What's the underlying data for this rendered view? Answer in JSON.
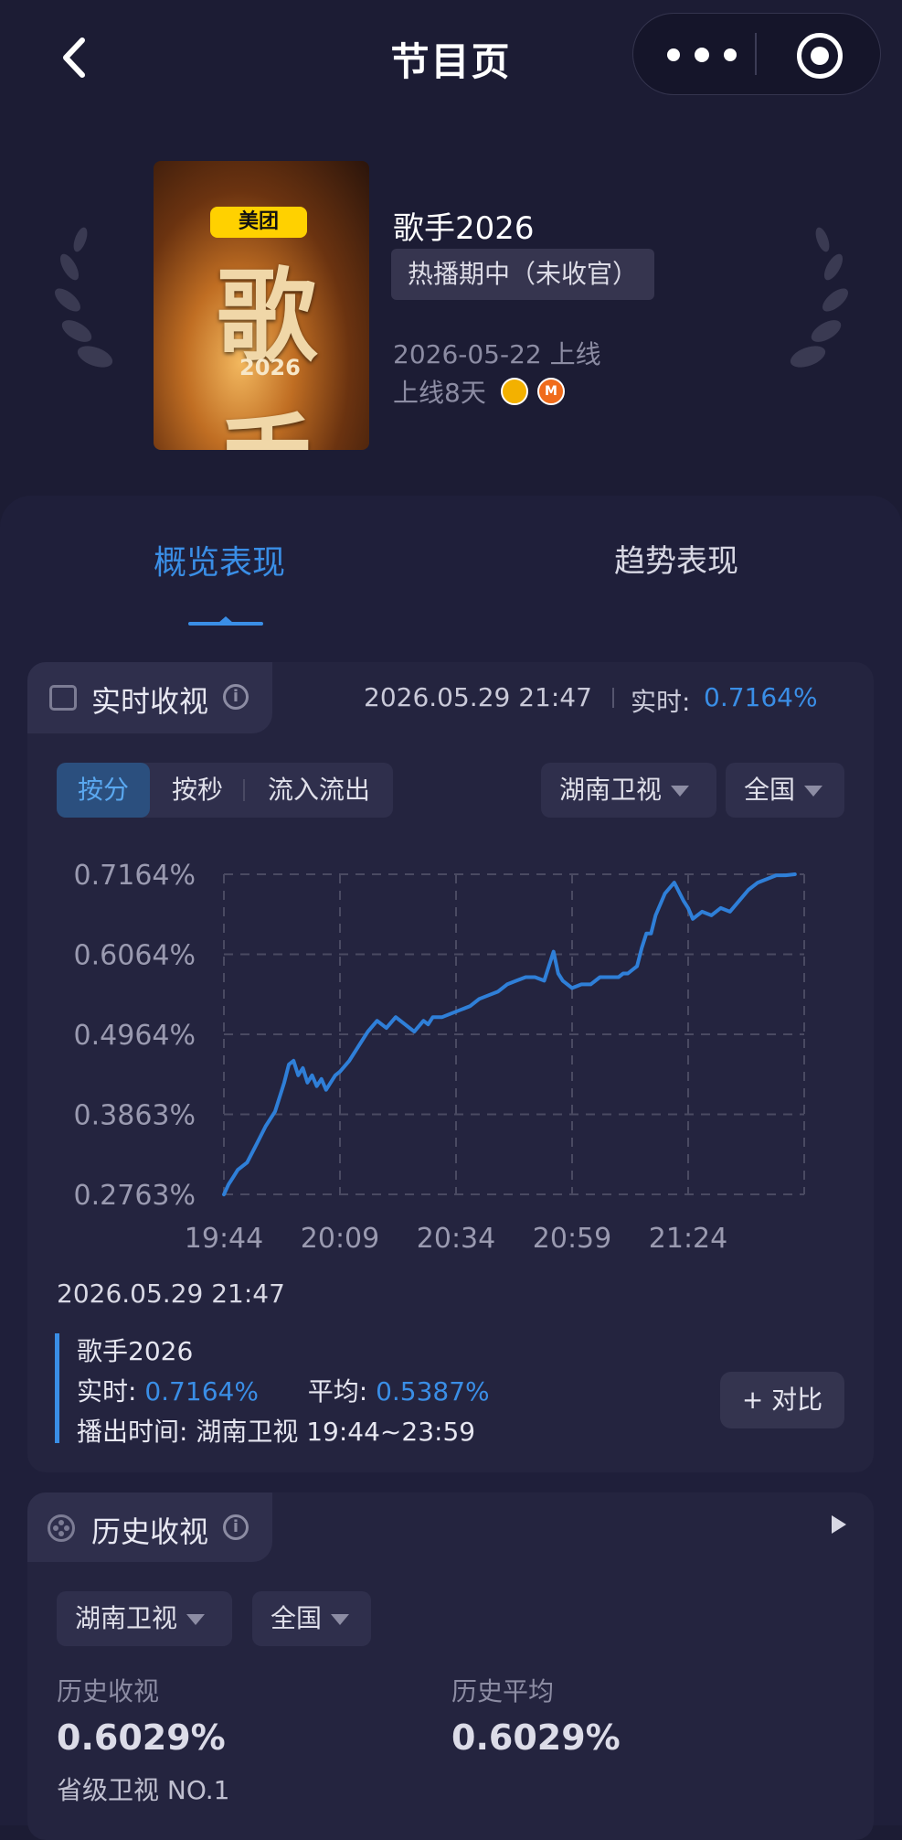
{
  "nav": {
    "title": "节目页"
  },
  "show": {
    "poster_logo": "美团",
    "poster_title": "歌手",
    "poster_year": "2026",
    "name": "歌手2026",
    "status": "热播期中（未收官）",
    "release": "2026-05-22 上线",
    "days_online": "上线8天",
    "channel_logos": [
      "hunan-tv-icon",
      "mango-tv-icon"
    ]
  },
  "tabs": [
    {
      "label": "概览表现",
      "active": true
    },
    {
      "label": "趋势表现",
      "active": false
    }
  ],
  "realtime": {
    "title": "实时收视",
    "timestamp": "2026.05.29 21:47",
    "current_label": "实时:",
    "current_value": "0.7164%",
    "modes": [
      "按分",
      "按秒",
      "流入流出"
    ],
    "channel_select": "湖南卫视",
    "region_select": "全国",
    "legend": {
      "date": "2026.05.29 21:47",
      "series": "歌手2026",
      "realtime_label": "实时:",
      "realtime_value": "0.7164%",
      "avg_label": "平均:",
      "avg_value": "0.5387%",
      "airtime_label": "播出时间:",
      "airtime_value": "湖南卫视 19:44~23:59"
    },
    "compare_button": "+ 对比"
  },
  "chart_data": {
    "type": "line",
    "x_ticks": [
      "19:44",
      "20:09",
      "20:34",
      "20:59",
      "21:24"
    ],
    "y_ticks": [
      "0.7164%",
      "0.6064%",
      "0.4964%",
      "0.3863%",
      "0.2763%"
    ],
    "ylim": [
      0.2763,
      0.7164
    ],
    "grid": true,
    "series_color": "#2f7fd8",
    "x_minutes_since_1944": [
      0,
      1,
      2,
      3,
      5,
      7,
      9,
      11,
      13,
      14,
      15,
      16,
      17,
      18,
      19,
      20,
      21,
      22,
      23,
      24,
      25,
      27,
      29,
      31,
      33,
      35,
      37,
      39,
      41,
      43,
      44,
      45,
      47,
      49,
      51,
      53,
      55,
      57,
      59,
      61,
      63,
      65,
      67,
      69,
      70,
      71,
      72,
      73,
      75,
      77,
      79,
      81,
      83,
      85,
      86,
      87,
      88,
      89,
      90,
      91,
      92,
      93,
      95,
      97,
      99,
      100,
      101,
      103,
      105,
      107,
      109,
      111,
      113,
      115,
      117,
      119,
      121,
      123
    ],
    "values": [
      0.276,
      0.29,
      0.3,
      0.31,
      0.32,
      0.345,
      0.37,
      0.39,
      0.43,
      0.455,
      0.46,
      0.44,
      0.45,
      0.43,
      0.44,
      0.425,
      0.435,
      0.42,
      0.43,
      0.44,
      0.445,
      0.46,
      0.48,
      0.5,
      0.515,
      0.505,
      0.52,
      0.51,
      0.5,
      0.515,
      0.51,
      0.52,
      0.52,
      0.525,
      0.53,
      0.535,
      0.545,
      0.55,
      0.555,
      0.565,
      0.57,
      0.575,
      0.575,
      0.57,
      0.59,
      0.61,
      0.58,
      0.57,
      0.56,
      0.565,
      0.565,
      0.575,
      0.575,
      0.575,
      0.58,
      0.58,
      0.585,
      0.59,
      0.615,
      0.635,
      0.635,
      0.66,
      0.69,
      0.705,
      0.68,
      0.67,
      0.655,
      0.665,
      0.66,
      0.67,
      0.665,
      0.68,
      0.695,
      0.705,
      0.71,
      0.715,
      0.715,
      0.7164
    ]
  },
  "history": {
    "title": "历史收视",
    "channel_select": "湖南卫视",
    "region_select": "全国",
    "metrics": [
      {
        "label": "历史收视",
        "value": "0.6029%"
      },
      {
        "label": "历史平均",
        "value": "0.6029%"
      }
    ],
    "rank": "省级卫视 NO.1"
  }
}
